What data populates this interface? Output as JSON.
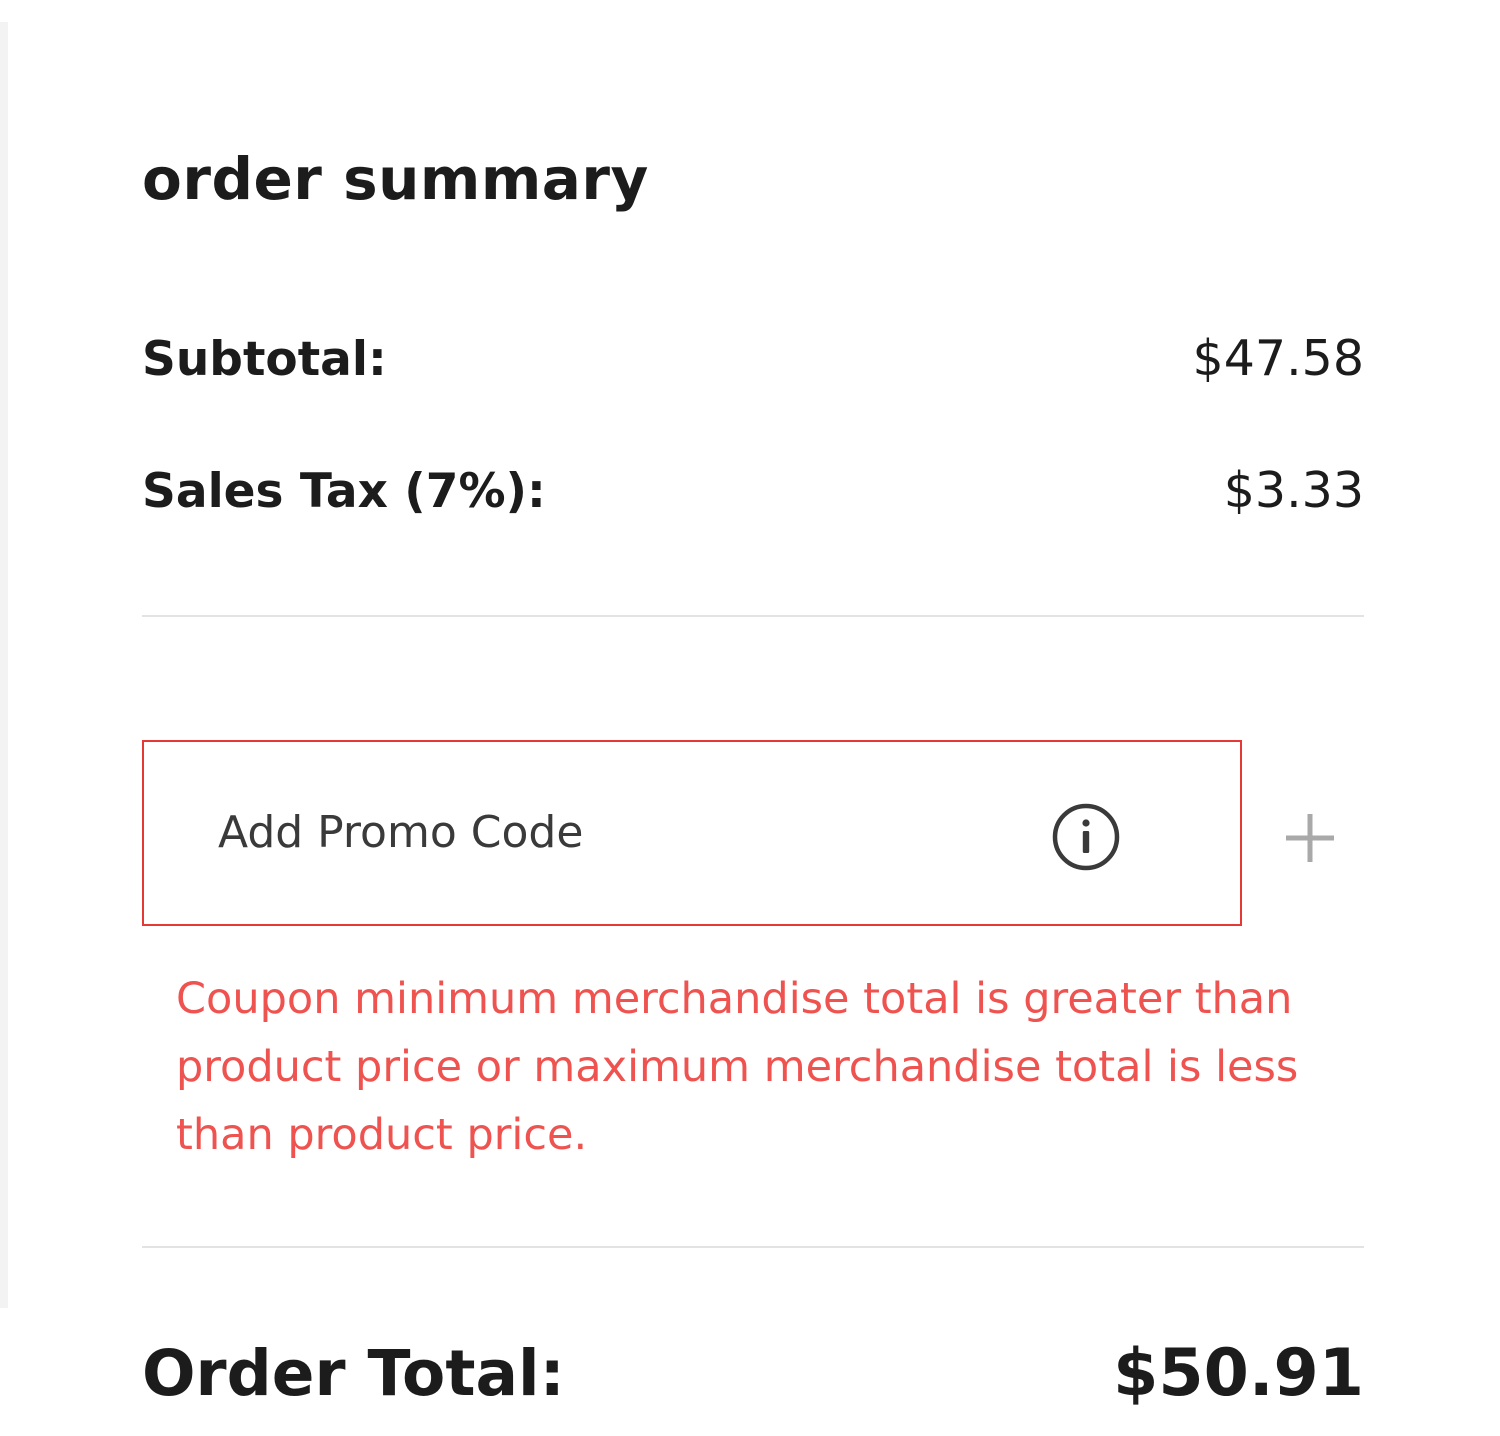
{
  "order_summary": {
    "title": "order summary",
    "subtotal": {
      "label": "Subtotal:",
      "value": "$47.58"
    },
    "sales_tax": {
      "label": "Sales Tax (7%):",
      "value": "$3.33"
    },
    "promo": {
      "placeholder": "Add Promo Code",
      "value": "",
      "info_icon": "info-icon",
      "add_icon": "plus-icon",
      "error_message": "Coupon minimum merchandise total is greater than product price or maximum merchandise total is less than product price.",
      "error_color": "#ef5350",
      "border_color": "#e53935"
    },
    "order_total": {
      "label": "Order Total:",
      "value": "$50.91"
    }
  }
}
